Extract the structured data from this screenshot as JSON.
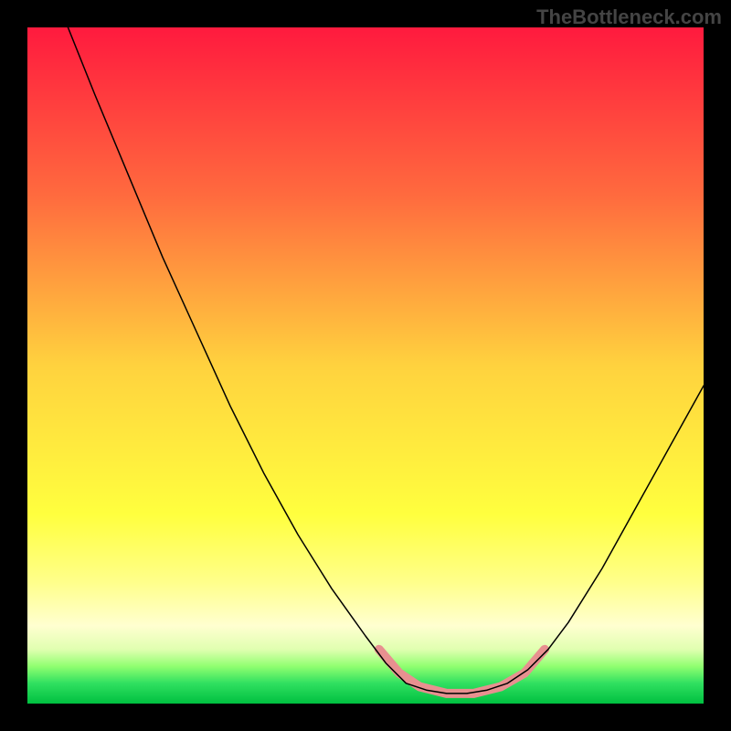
{
  "watermark": "TheBottleneck.com",
  "chart_data": {
    "type": "line",
    "title": "",
    "xlabel": "",
    "ylabel": "",
    "xlim": [
      0,
      100
    ],
    "ylim": [
      0,
      100
    ],
    "background_gradient": {
      "stops": [
        {
          "offset": 0,
          "color": "#ff1a3e"
        },
        {
          "offset": 0.25,
          "color": "#ff6b3e"
        },
        {
          "offset": 0.5,
          "color": "#ffd23e"
        },
        {
          "offset": 0.72,
          "color": "#ffff3e"
        },
        {
          "offset": 0.82,
          "color": "#ffff8a"
        },
        {
          "offset": 0.885,
          "color": "#ffffd0"
        },
        {
          "offset": 0.92,
          "color": "#e0ffb0"
        },
        {
          "offset": 0.945,
          "color": "#90ff70"
        },
        {
          "offset": 0.97,
          "color": "#30e060"
        },
        {
          "offset": 1.0,
          "color": "#00c040"
        }
      ]
    },
    "series": [
      {
        "name": "bottleneck-curve",
        "color": "#000000",
        "stroke_width": 1.5,
        "points": [
          {
            "x": 6,
            "y": 100
          },
          {
            "x": 10,
            "y": 90
          },
          {
            "x": 15,
            "y": 78
          },
          {
            "x": 20,
            "y": 66
          },
          {
            "x": 25,
            "y": 55
          },
          {
            "x": 30,
            "y": 44
          },
          {
            "x": 35,
            "y": 34
          },
          {
            "x": 40,
            "y": 25
          },
          {
            "x": 45,
            "y": 17
          },
          {
            "x": 50,
            "y": 10
          },
          {
            "x": 53,
            "y": 6
          },
          {
            "x": 56,
            "y": 3
          },
          {
            "x": 59,
            "y": 2
          },
          {
            "x": 62,
            "y": 1.5
          },
          {
            "x": 65,
            "y": 1.5
          },
          {
            "x": 68,
            "y": 2
          },
          {
            "x": 71,
            "y": 3
          },
          {
            "x": 74,
            "y": 5
          },
          {
            "x": 77,
            "y": 8
          },
          {
            "x": 80,
            "y": 12
          },
          {
            "x": 85,
            "y": 20
          },
          {
            "x": 90,
            "y": 29
          },
          {
            "x": 95,
            "y": 38
          },
          {
            "x": 100,
            "y": 47
          }
        ]
      },
      {
        "name": "highlight-segment",
        "color": "#e89090",
        "stroke_width": 10,
        "points": [
          {
            "x": 52,
            "y": 8
          },
          {
            "x": 55,
            "y": 4.5
          },
          {
            "x": 58,
            "y": 2.5
          },
          {
            "x": 62,
            "y": 1.5
          },
          {
            "x": 66,
            "y": 1.5
          },
          {
            "x": 70,
            "y": 2.5
          },
          {
            "x": 73.5,
            "y": 4.5
          },
          {
            "x": 76.5,
            "y": 8
          }
        ]
      }
    ]
  }
}
